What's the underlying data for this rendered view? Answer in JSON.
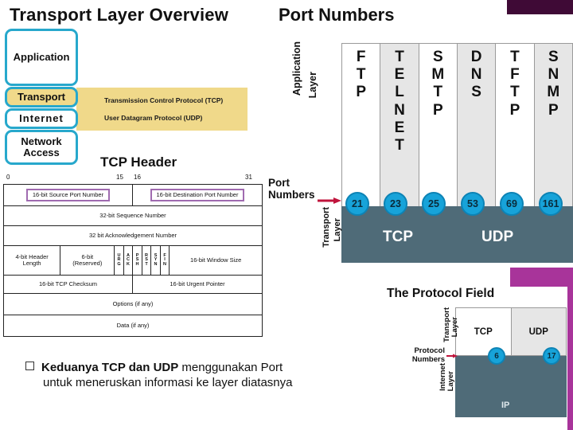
{
  "decor": {
    "top_bar_color": "#3f0a36",
    "magenta_color": "#a8349a"
  },
  "transport_overview": {
    "title": "Transport Layer Overview",
    "layers": [
      {
        "label": "Application"
      },
      {
        "label": "Transport"
      },
      {
        "label": "Internet"
      },
      {
        "label": "Network\nAccess"
      }
    ],
    "layer_labels": {
      "application": "Application",
      "transport": "Transport",
      "internet": "Internet",
      "network_access_line1": "Network",
      "network_access_line2": "Access"
    },
    "protocols": [
      "Transmission Control Protocol (TCP)",
      "User Datagram Protocol (UDP)"
    ],
    "accent_border_color": "#27a8cc",
    "highlight_color": "#f0d98a"
  },
  "tcp_header": {
    "title": "TCP Header",
    "ruler": [
      "0",
      "15",
      "16",
      "31"
    ],
    "fields": {
      "source_port": "16-bit Source Port Number",
      "destination_port": "16-bit Destination Port Number",
      "sequence": "32-bit Sequence Number",
      "acknowledgement": "32 bit Acknowledgement Number",
      "header_length_l1": "4-bit Header",
      "header_length_l2": "Length",
      "reserved_l1": "6-bit",
      "reserved_l2": "(Reserved)",
      "window_size": "16-bit Window Size",
      "checksum": "16-bit TCP Checksum",
      "urgent_pointer": "16-bit Urgent Pointer",
      "options": "Options (if any)",
      "data": "Data (if any)"
    },
    "flags": [
      {
        "l1": "U",
        "l2": "R",
        "l3": "G"
      },
      {
        "l1": "A",
        "l2": "C",
        "l3": "K"
      },
      {
        "l1": "P",
        "l2": "S",
        "l3": "H"
      },
      {
        "l1": "R",
        "l2": "S",
        "l3": "T"
      },
      {
        "l1": "S",
        "l2": "Y",
        "l3": "N"
      },
      {
        "l1": "F",
        "l2": "I",
        "l3": "N"
      }
    ],
    "highlight_color": "#a06bb0"
  },
  "bullet": {
    "bold_part": "Keduanya TCP dan UDP",
    "rest_line1": " menggunakan Port",
    "line2": "untuk meneruskan informasi ke layer diatasnya"
  },
  "port_numbers": {
    "title": "Port Numbers",
    "application_layer_l1": "Application",
    "application_layer_l2": "Layer",
    "port_numbers_l1": "Port",
    "port_numbers_l2": "Numbers",
    "transport_layer_l1": "Transport",
    "transport_layer_l2": "Layer",
    "transport_bar_color": "#4f6b78",
    "circle_color": "#17a3d9",
    "columns": [
      {
        "name": "FTP",
        "letters": [
          "F",
          "T",
          "P"
        ],
        "port": "21",
        "shaded": false
      },
      {
        "name": "TELNET",
        "letters": [
          "T",
          "E",
          "L",
          "N",
          "E",
          "T"
        ],
        "port": "23",
        "shaded": true
      },
      {
        "name": "SMTP",
        "letters": [
          "S",
          "M",
          "T",
          "P"
        ],
        "port": "25",
        "shaded": false
      },
      {
        "name": "DNS",
        "letters": [
          "D",
          "N",
          "S"
        ],
        "port": "53",
        "shaded": true
      },
      {
        "name": "TFTP",
        "letters": [
          "T",
          "F",
          "T",
          "P"
        ],
        "port": "69",
        "shaded": false
      },
      {
        "name": "SNMP",
        "letters": [
          "S",
          "N",
          "M",
          "P"
        ],
        "port": "161",
        "shaded": true
      }
    ],
    "transport_protocols": [
      {
        "label": "TCP"
      },
      {
        "label": "UDP"
      }
    ],
    "tcp_label": "TCP",
    "udp_label": "UDP"
  },
  "protocol_field": {
    "title": "The Protocol Field",
    "transport_layer_l1": "Transport",
    "transport_layer_l2": "Layer",
    "internet_layer_l1": "Internet",
    "internet_layer_l2": "Layer",
    "protocol_numbers_l1": "Protocol",
    "protocol_numbers_l2": "Numbers",
    "tcp_label": "TCP",
    "udp_label": "UDP",
    "ip_label": "IP",
    "tcp_number": "6",
    "udp_number": "17"
  }
}
